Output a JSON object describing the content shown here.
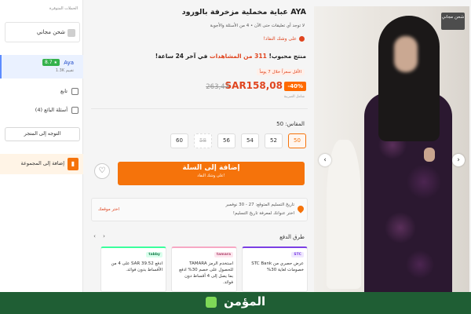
{
  "sidebar": {
    "section_title": "الحملات المتوفرة",
    "shipping_label": "شحن مجاني",
    "seller": {
      "name": "Aya",
      "rating": "8.7",
      "rating_star": "★",
      "reviews": "1.3K تقييم"
    },
    "follow_label": "تابع",
    "questions_label": "أسئلة البائع (4)",
    "store_button": "التوجه إلى المتجر",
    "collection_button": "إضافة إلى المجموعة",
    "collection_icon": "bookmark-icon"
  },
  "product": {
    "title": "AYA عباية مخملية مزخرفة بالورود",
    "review_line": "لا توجد أي تعليقات حتى الآن • 4 من الأسئلة والأجوبة",
    "sale_line": "على وشك النفاذ!",
    "popular_line_prefix": "منتج محبوب!",
    "popular_line_highlight": "311 من المشاهدات",
    "popular_line_suffix": "في آخر 24 ساعة!",
    "lowest_tag": "الأقل سعراً خلال 7 يوماً",
    "discount_badge": "-40%",
    "price_now": "SAR158,08",
    "price_old": "263,47",
    "vat_note": "شامل الضريبة",
    "size_label": "المقاس: 50",
    "sizes": [
      "50",
      "52",
      "54",
      "56",
      "58",
      "60"
    ],
    "selected_size": "50",
    "disabled_size": "58",
    "add_to_cart": "إضافة إلى السلة",
    "add_to_cart_sub": "على وشك النفاذ!",
    "wishlist_icon": "heart-icon"
  },
  "delivery": {
    "line1": "تاريخ التسليم المتوقع: 27 - 30 نوفمبر",
    "line2": "اختر عنوانك لمعرفة تاريخ التسليم!",
    "choose_location": "اختر موقعك"
  },
  "payment": {
    "title": "طرق الدفع",
    "cards": [
      {
        "logo": "STC",
        "text": "عرض حصري من STC Bank خصومات لغاية 30%"
      },
      {
        "logo": "tamara",
        "text": "استخدم الرمز TAMARA للحصول على خصم 30% ادفع بما يصل إلى 4 أقساط دون فوائد."
      },
      {
        "logo": "tabby",
        "text": "ادفع SAR 39.52 على 4 من الأقساط بدون فوائد."
      }
    ]
  },
  "gallery": {
    "ship_badge": "شحن مجاني",
    "prev_icon": "chevron-left-icon",
    "next_icon": "chevron-right-icon"
  },
  "footer": {
    "brand": "المؤمن"
  },
  "colors": {
    "accent": "#f5730b",
    "price": "#e0451f",
    "seller_bg": "#eaf1ff",
    "footer": "#1f5e34"
  }
}
